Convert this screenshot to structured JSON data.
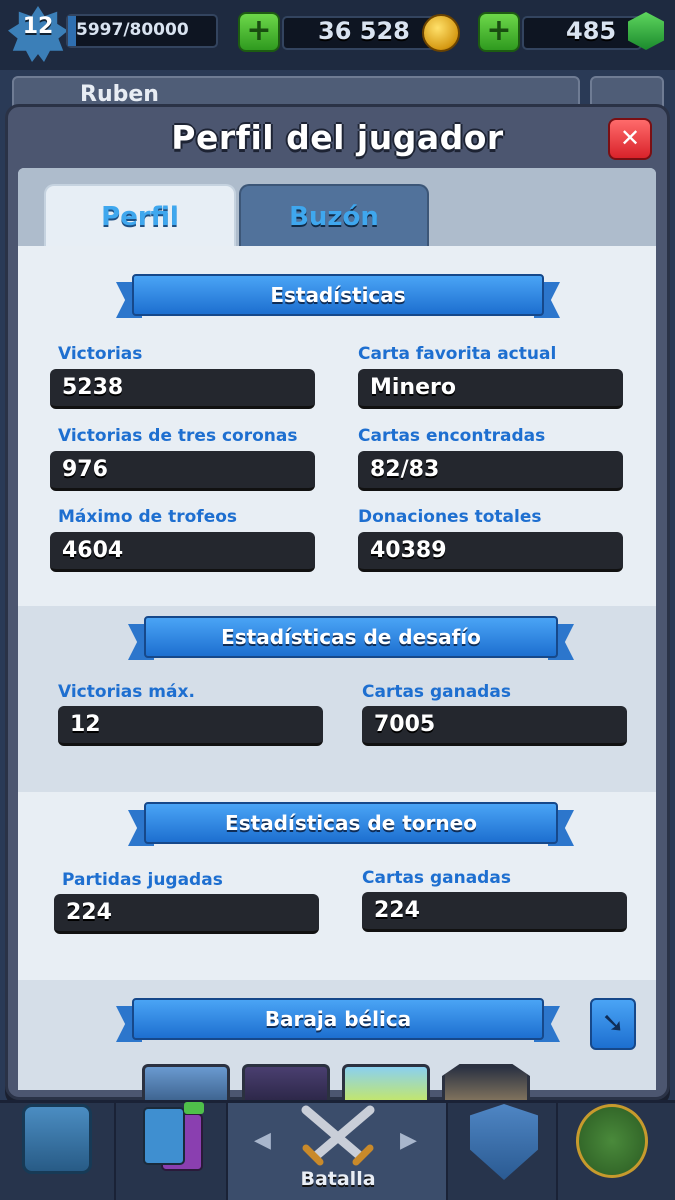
{
  "top_bar": {
    "level": "12",
    "xp": "5997/80000",
    "gold": "36 528",
    "gems": "485",
    "add_gold_label": "+",
    "add_gems_label": "+"
  },
  "behind": {
    "player_name": "Ruben"
  },
  "modal": {
    "title": "Perfil del jugador",
    "close_label": "✕",
    "tabs": [
      {
        "label": "Perfil",
        "active": true
      },
      {
        "label": "Buzón",
        "active": false
      }
    ]
  },
  "sections": {
    "stats": {
      "title": "Estadísticas",
      "items": [
        {
          "label": "Victorias",
          "value": "5238"
        },
        {
          "label": "Carta favorita actual",
          "value": "Minero"
        },
        {
          "label": "Victorias de tres coronas",
          "value": "976"
        },
        {
          "label": "Cartas encontradas",
          "value": "82/83"
        },
        {
          "label": "Máximo de trofeos",
          "value": "4604"
        },
        {
          "label": "Donaciones totales",
          "value": "40389"
        }
      ]
    },
    "challenge": {
      "title": "Estadísticas de desafío",
      "items": [
        {
          "label": "Victorias máx.",
          "value": "12"
        },
        {
          "label": "Cartas ganadas",
          "value": "7005"
        }
      ]
    },
    "tournament": {
      "title": "Estadísticas de torneo",
      "items": [
        {
          "label": "Partidas jugadas",
          "value": "224"
        },
        {
          "label": "Cartas ganadas",
          "value": "224"
        }
      ]
    },
    "deck": {
      "title": "Baraja bélica"
    }
  },
  "bottom_nav": {
    "active_label": "Batalla",
    "left_arrow": "◀",
    "right_arrow": "▶"
  },
  "colors": {
    "label_blue": "#1e6fd0",
    "value_box": "#24272e",
    "ribbon_blue": "#2c76cc",
    "close_red": "#d9222a",
    "plus_green": "#2f9a1f"
  }
}
